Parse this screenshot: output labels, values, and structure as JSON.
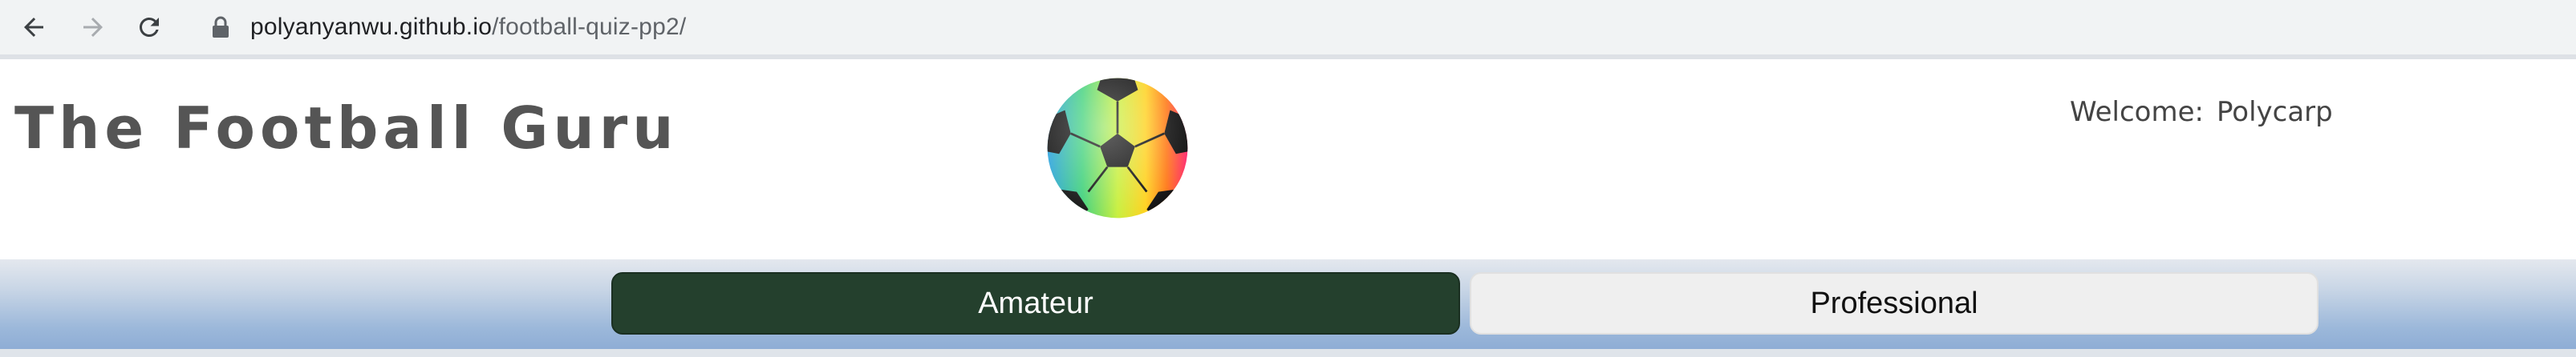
{
  "browser": {
    "url_host": "polyanyanwu.github.io",
    "url_path": "/football-quiz-pp2/",
    "icons": [
      "back-arrow-icon",
      "forward-arrow-icon",
      "reload-icon",
      "lock-icon"
    ]
  },
  "header": {
    "title": "The Football Guru",
    "logo_icon": "football-icon",
    "welcome_label": "Welcome:",
    "username": "Polycarp"
  },
  "levels": {
    "amateur_label": "Amateur",
    "professional_label": "Professional",
    "active": "Amateur",
    "active_color": "#24402d",
    "inactive_color": "#efefef"
  }
}
